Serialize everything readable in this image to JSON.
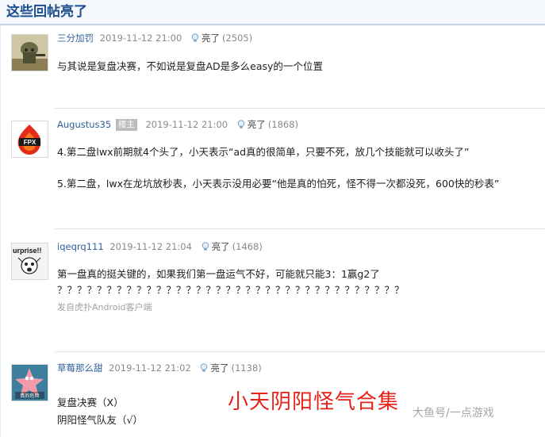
{
  "section": {
    "title": "这些回帖亮了"
  },
  "posts": [
    {
      "username": "三分加罚",
      "badge": "",
      "time": "2019-11-12 21:00",
      "like_label": "亮了",
      "like_count": "(2505)",
      "lines": [
        "与其说是复盘决赛，不如说是复盘AD是多么easy的一个位置"
      ],
      "source": ""
    },
    {
      "username": "Augustus35",
      "badge": "楼主",
      "time": "2019-11-12 21:00",
      "like_label": "亮了",
      "like_count": "(1868)",
      "lines": [
        "4.第二盘lwx前期就4个头了，小天表示“ad真的很简单，只要不死，放几个技能就可以收头了”",
        "5.第二盘，lwx在龙坑放秒表，小天表示没用必要“他是真的怕死，怪不得一次都没死，600快的秒表”"
      ],
      "source": "",
      "avatar_text": "FPX"
    },
    {
      "username": "iqeqrq111",
      "badge": "",
      "time": "2019-11-12 21:04",
      "like_label": "亮了",
      "like_count": "(1468)",
      "lines": [
        "第一盘真的挺关键的，如果我们第一盘运气不好，可能就只能3：1赢g2了",
        "？？？？？？？？？？？？？？？？？？？？？？？？？？？？？？？？？？？"
      ],
      "source": "发自虎扑Android客户端",
      "avatar_text": "urprise!!"
    },
    {
      "username": "草莓那么甜",
      "badge": "",
      "time": "2019-11-12 21:02",
      "like_label": "亮了",
      "like_count": "(1138)",
      "lines": [
        "复盘决赛（X）",
        "阴阳怪气队友（√）"
      ],
      "source": "",
      "avatar_text": "真的危险"
    }
  ],
  "overlay": {
    "title": "小天阴阳怪气合集"
  },
  "watermark": {
    "text": "大鱼号/一点游戏"
  },
  "colors": {
    "accent": "#1d4f8f",
    "username": "#2f5f9a",
    "overlay": "#e8211a"
  }
}
